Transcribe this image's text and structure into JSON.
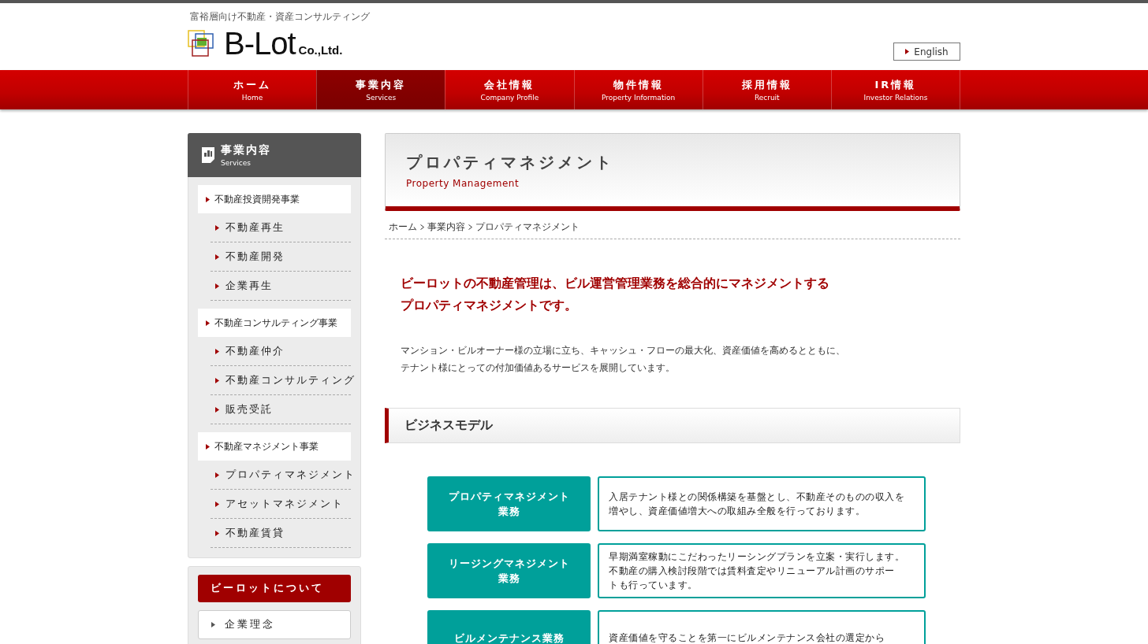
{
  "header": {
    "tagline": "富裕層向け不動産・資産コンサルティング",
    "logo_main": "B-Lot",
    "logo_sub": "Co.,Ltd.",
    "language_link": "English"
  },
  "nav": [
    {
      "label": "ホーム",
      "sub": "Home",
      "selected": false
    },
    {
      "label": "事業内容",
      "sub": "Services",
      "selected": true
    },
    {
      "label": "会社情報",
      "sub": "Company Profile",
      "selected": false
    },
    {
      "label": "物件情報",
      "sub": "Property Information",
      "selected": false
    },
    {
      "label": "採用情報",
      "sub": "Recruit",
      "selected": false
    },
    {
      "label": "IR情報",
      "sub": "Investor Relations",
      "selected": false
    }
  ],
  "sidebar": {
    "title": "事業内容",
    "subtitle": "Services",
    "groups": [
      {
        "label": "不動産投資開発事業",
        "children": [
          {
            "label": "不動産再生"
          },
          {
            "label": "不動産開発"
          },
          {
            "label": "企業再生"
          }
        ]
      },
      {
        "label": "不動産コンサルティング事業",
        "children": [
          {
            "label": "不動産仲介"
          },
          {
            "label": "不動産コンサルティング"
          },
          {
            "label": "販売受託"
          }
        ]
      },
      {
        "label": "不動産マネジメント事業",
        "children": [
          {
            "label": "プロパティマネジメント"
          },
          {
            "label": "アセットマネジメント"
          },
          {
            "label": "不動産賃貸"
          }
        ]
      }
    ],
    "about": {
      "title": "ビーロットについて",
      "items": [
        "企業理念"
      ]
    }
  },
  "page": {
    "title": "プロパティマネジメント",
    "subtitle": "Property Management",
    "breadcrumb": [
      "ホーム",
      "事業内容",
      "プロパティマネジメント"
    ],
    "lead": [
      "ビーロットの不動産管理は、ビル運営管理業務を総合的にマネジメントする",
      "プロパティマネジメントです。"
    ],
    "intro": [
      "マンション・ビルオーナー様の立場に立ち、キャッシュ・フローの最大化、資産価値を高めるとともに、",
      "テナント様にとっての付加価値あるサービスを展開しています。"
    ],
    "section_title": "ビジネスモデル",
    "business_model": [
      {
        "name": [
          "プロパティマネジメント",
          "業務"
        ],
        "description": [
          "入居テナント様との関係構築を基盤とし、不動産そのものの収入を",
          "増やし、資産価値増大への取組み全般を行っております。"
        ]
      },
      {
        "name": [
          "リージングマネジメント",
          "業務"
        ],
        "description": [
          "早期満室稼動にこだわったリーシングプランを立案・実行します。",
          "不動産の購入検討段階では賃料査定やリニューアル計画のサポー",
          "トも行っています。"
        ]
      },
      {
        "name": [
          "ビルメンテナンス業務"
        ],
        "description": [
          "資産価値を守ることを第一にビルメンテナンス会社の選定から"
        ]
      }
    ]
  }
}
